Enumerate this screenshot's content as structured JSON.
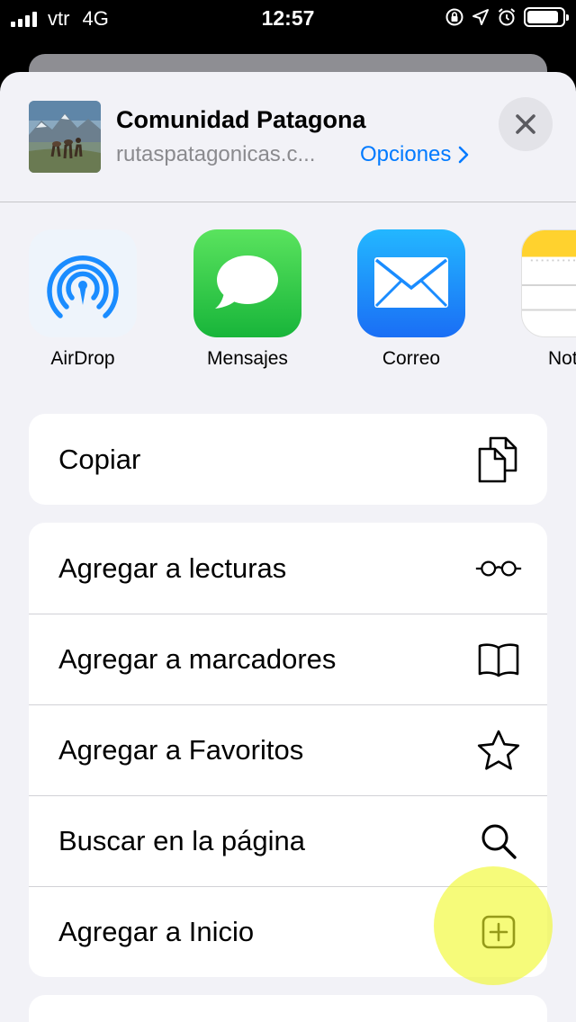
{
  "status_bar": {
    "carrier": "vtr",
    "network": "4G",
    "time": "12:57",
    "battery_level": 0.9,
    "icons": [
      "rotation-lock-icon",
      "location-arrow-icon",
      "alarm-icon",
      "battery-icon"
    ]
  },
  "header": {
    "title": "Comunidad Patagona",
    "url": "rutaspatagonicas.c...",
    "options_label": "Opciones",
    "options_icon": "chevron-right-icon",
    "close_icon": "close-icon"
  },
  "apps": [
    {
      "label": "AirDrop",
      "icon": "airdrop-icon"
    },
    {
      "label": "Mensajes",
      "icon": "messages-icon"
    },
    {
      "label": "Correo",
      "icon": "mail-icon"
    },
    {
      "label": "Not",
      "icon": "notes-icon"
    }
  ],
  "actions_primary": [
    {
      "label": "Copiar",
      "icon": "copy-icon"
    }
  ],
  "actions_secondary": [
    {
      "label": "Agregar a lecturas",
      "icon": "glasses-icon"
    },
    {
      "label": "Agregar a marcadores",
      "icon": "book-icon"
    },
    {
      "label": "Agregar a Favoritos",
      "icon": "star-icon"
    },
    {
      "label": "Buscar en la página",
      "icon": "search-icon"
    },
    {
      "label": "Agregar a Inicio",
      "icon": "add-square-icon"
    }
  ],
  "colors": {
    "accent": "#007aff",
    "sheet_background": "#f2f2f7",
    "highlight": "#f0f828",
    "messages_green": "#30c94c",
    "mail_blue": "#1a8cff"
  }
}
